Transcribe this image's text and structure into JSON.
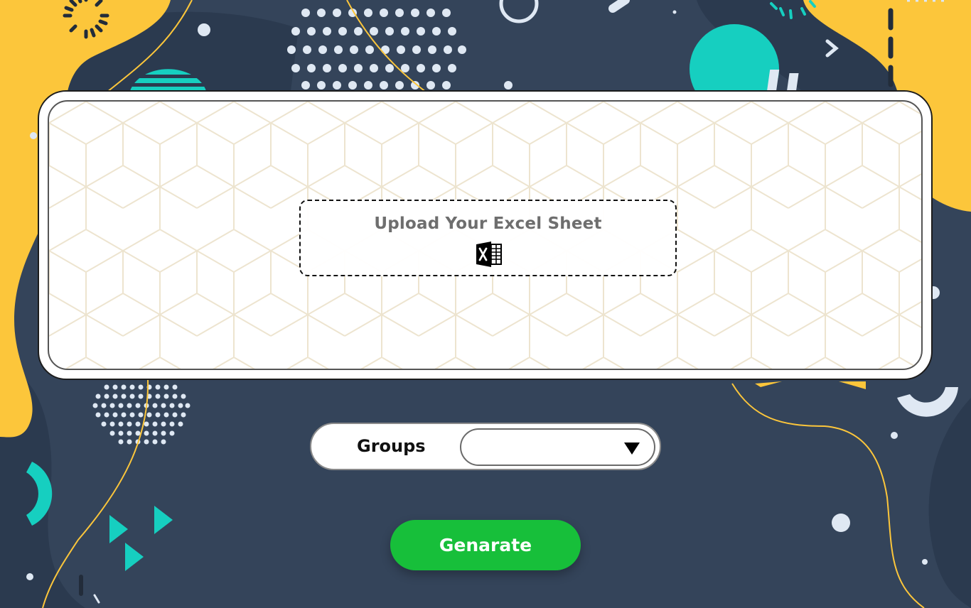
{
  "upload": {
    "label": "Upload Your Excel Sheet",
    "icon": "excel-icon"
  },
  "groups": {
    "label": "Groups",
    "selected_value": "",
    "icon": "chevron-down-icon"
  },
  "actions": {
    "generate_label": "Genarate"
  },
  "theme": {
    "background": "#34445a",
    "accent_yellow": "#fcc63b",
    "accent_teal": "#16cfc0",
    "button_green": "#17bf3a"
  }
}
